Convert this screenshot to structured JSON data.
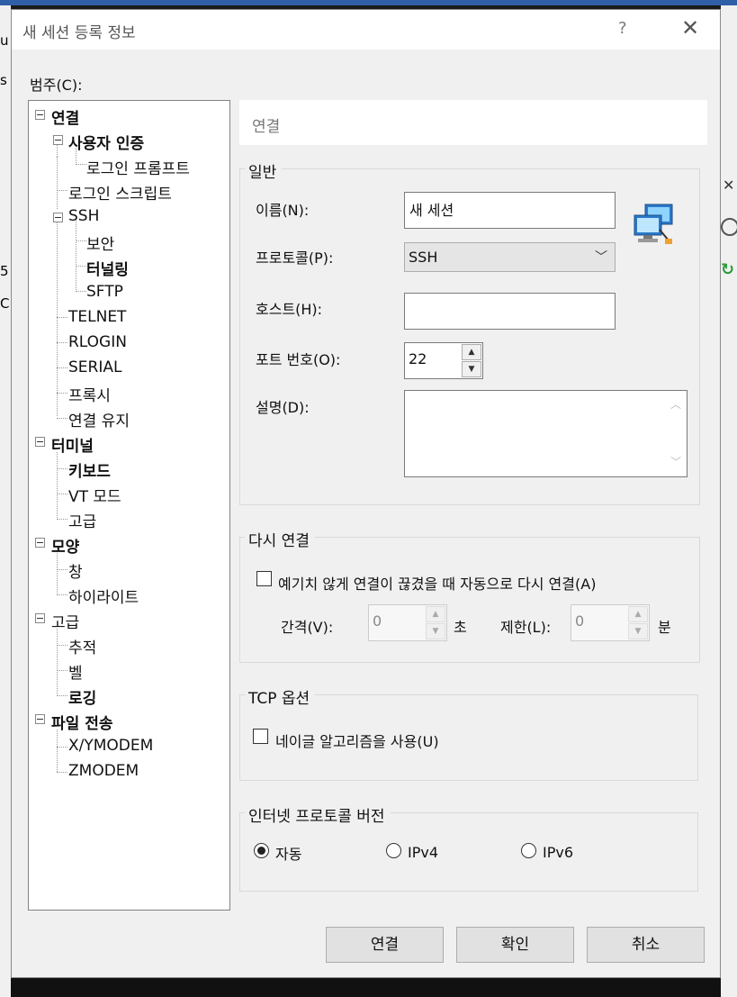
{
  "background": {
    "left_fragments": [
      "u",
      "s",
      "5",
      "C"
    ]
  },
  "dialog": {
    "title": "새 세션 등록 정보",
    "help_label": "?",
    "close_label": "✕",
    "category_label": "범주(C):"
  },
  "tree": [
    {
      "label": "연결",
      "bold": true
    },
    {
      "label": "사용자 인증",
      "bold": true
    },
    {
      "label": "로그인 프롬프트",
      "bold": false
    },
    {
      "label": "로그인 스크립트",
      "bold": false
    },
    {
      "label": "SSH",
      "bold": false
    },
    {
      "label": "보안",
      "bold": false
    },
    {
      "label": "터널링",
      "bold": true
    },
    {
      "label": "SFTP",
      "bold": false
    },
    {
      "label": "TELNET",
      "bold": false
    },
    {
      "label": "RLOGIN",
      "bold": false
    },
    {
      "label": "SERIAL",
      "bold": false
    },
    {
      "label": "프록시",
      "bold": false
    },
    {
      "label": "연결 유지",
      "bold": false
    },
    {
      "label": "터미널",
      "bold": true
    },
    {
      "label": "키보드",
      "bold": true
    },
    {
      "label": "VT 모드",
      "bold": false
    },
    {
      "label": "고급",
      "bold": false
    },
    {
      "label": "모양",
      "bold": true
    },
    {
      "label": "창",
      "bold": false
    },
    {
      "label": "하이라이트",
      "bold": false
    },
    {
      "label": "고급",
      "bold": false
    },
    {
      "label": "추적",
      "bold": false
    },
    {
      "label": "벨",
      "bold": false
    },
    {
      "label": "로깅",
      "bold": true
    },
    {
      "label": "파일 전송",
      "bold": true
    },
    {
      "label": "X/YMODEM",
      "bold": false
    },
    {
      "label": "ZMODEM",
      "bold": false
    }
  ],
  "panel": {
    "header": "연결",
    "general": {
      "title": "일반",
      "name_label": "이름(N):",
      "name_value": "새 세션",
      "protocol_label": "프로토콜(P):",
      "protocol_value": "SSH",
      "host_label": "호스트(H):",
      "host_value": "",
      "port_label": "포트 번호(O):",
      "port_value": "22",
      "description_label": "설명(D):",
      "description_value": ""
    },
    "reconnect": {
      "title": "다시 연결",
      "auto_label": "예기치 않게 연결이 끊겼을 때 자동으로 다시 연결(A)",
      "auto_checked": false,
      "interval_label": "간격(V):",
      "interval_value": "0",
      "interval_unit": "초",
      "limit_label": "제한(L):",
      "limit_value": "0",
      "limit_unit": "분"
    },
    "tcp": {
      "title": "TCP 옵션",
      "nagle_label": "네이글 알고리즘을 사용(U)",
      "nagle_checked": false
    },
    "ip": {
      "title": "인터넷 프로토콜 버전",
      "options": [
        "자동",
        "IPv4",
        "IPv6"
      ],
      "selected": "자동"
    }
  },
  "buttons": {
    "connect": "연결",
    "ok": "확인",
    "cancel": "취소"
  }
}
